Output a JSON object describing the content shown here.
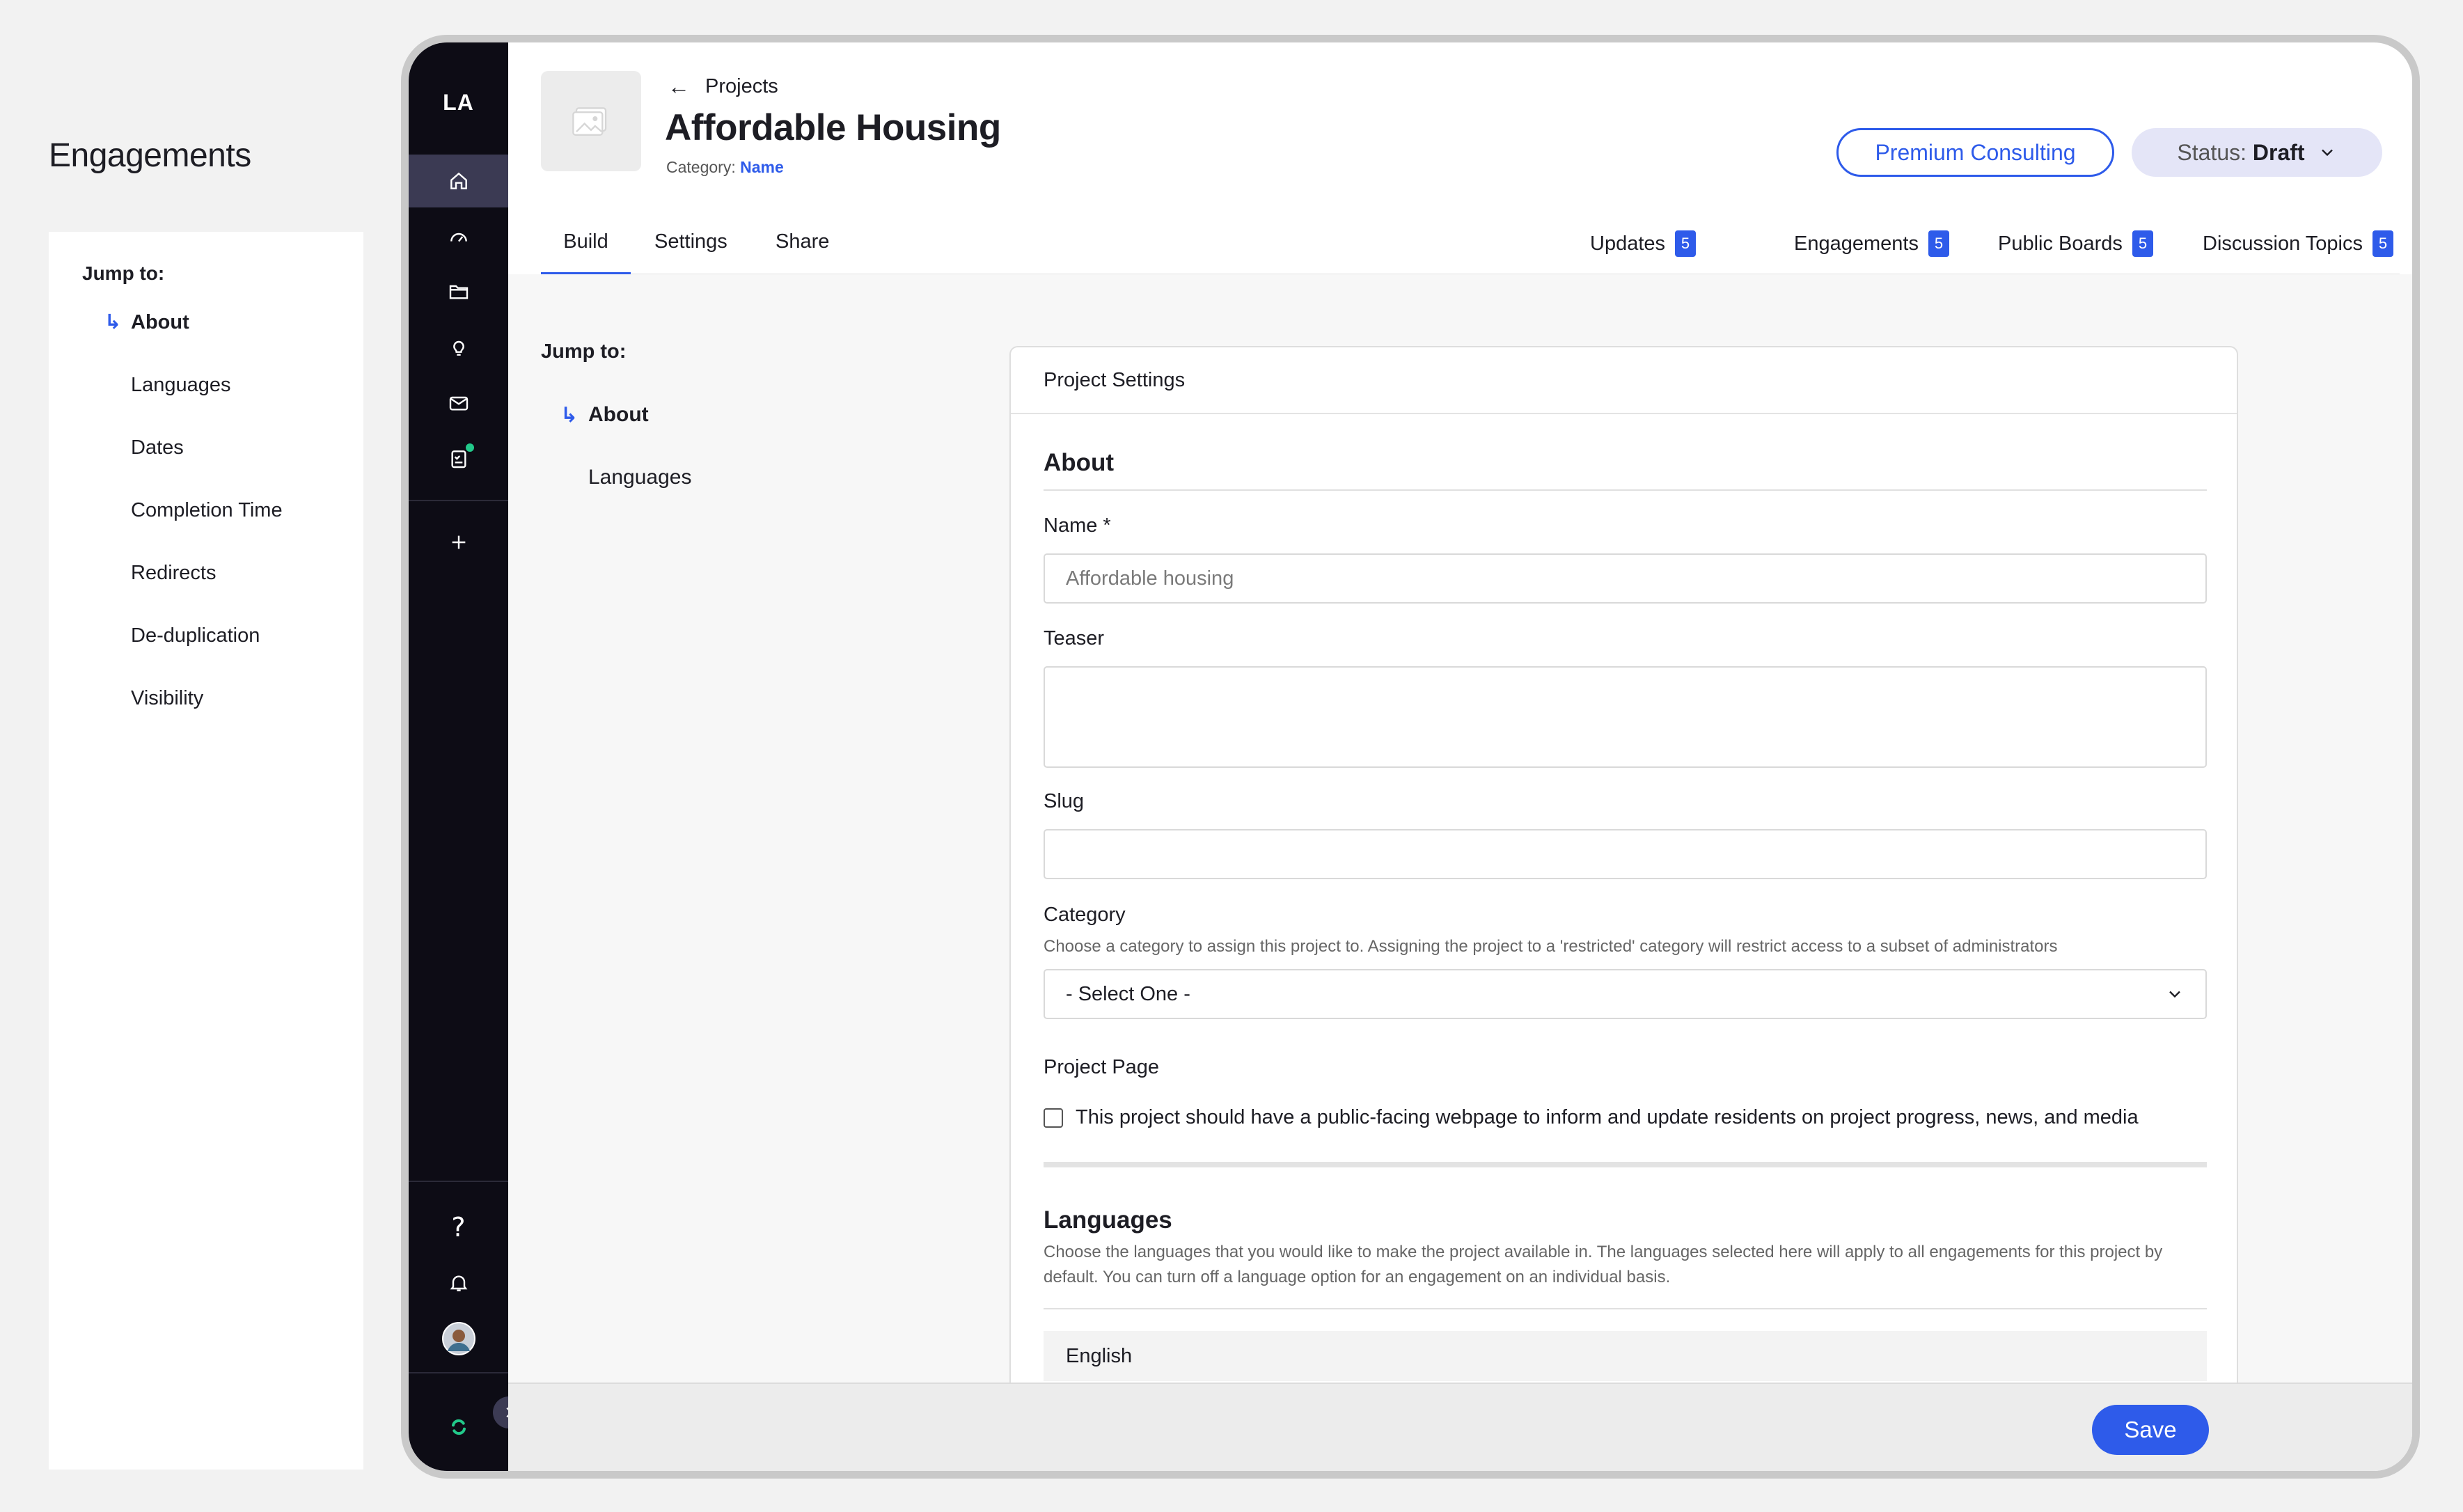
{
  "outer": {
    "title": "Engagements",
    "jump_label": "Jump to:",
    "items": [
      "About",
      "Languages",
      "Dates",
      "Completion Time",
      "Redirects",
      "De-duplication",
      "Visibility"
    ]
  },
  "rail": {
    "logo": "LA",
    "icons": [
      "home-icon",
      "dashboard-icon",
      "folder-icon",
      "lightbulb-icon",
      "mail-icon",
      "checklist-icon",
      "plus-icon",
      "help-icon",
      "bell-icon",
      "avatar",
      "brand-logo-icon"
    ],
    "help_glyph": "?"
  },
  "header": {
    "back_label": "Projects",
    "title": "Affordable Housing",
    "category_label": "Category:",
    "category_value": "Name",
    "premium_label": "Premium Consulting",
    "status_label": "Status:",
    "status_value": "Draft"
  },
  "tabs": {
    "left": [
      "Build",
      "Settings",
      "Share"
    ],
    "right": [
      {
        "label": "Updates",
        "count": "5"
      },
      {
        "label": "Engagements",
        "count": "5"
      },
      {
        "label": "Public Boards",
        "count": "5"
      },
      {
        "label": "Discussion Topics",
        "count": "5"
      }
    ]
  },
  "jump": {
    "label": "Jump to:",
    "items": [
      "About",
      "Languages"
    ]
  },
  "card": {
    "header": "Project Settings",
    "about_title": "About",
    "name_label": "Name *",
    "name_placeholder": "Affordable housing",
    "teaser_label": "Teaser",
    "slug_label": "Slug",
    "category_label": "Category",
    "category_help": "Choose a category to assign this project to. Assigning the project to a 'restricted' category will restrict access to a subset of administrators",
    "category_select": "- Select One -",
    "project_page_label": "Project Page",
    "project_page_checkbox": "This project should have a public-facing webpage to inform and update residents on project progress, news, and media",
    "languages_title": "Languages",
    "languages_help": "Choose the languages that you would like to make the project available in. The languages selected here will apply to all engagements for this project by default. You can turn off a language option for an engagement on an individual basis.",
    "language_first": "English"
  },
  "footer": {
    "save_label": "Save"
  },
  "colors": {
    "accent": "#2e5bea",
    "rail_bg": "#0d0c15",
    "rail_active": "#3b3a53",
    "badge_bg": "#2e5bea",
    "status_bg": "#e4e5f7",
    "dot_green": "#22c98a"
  }
}
